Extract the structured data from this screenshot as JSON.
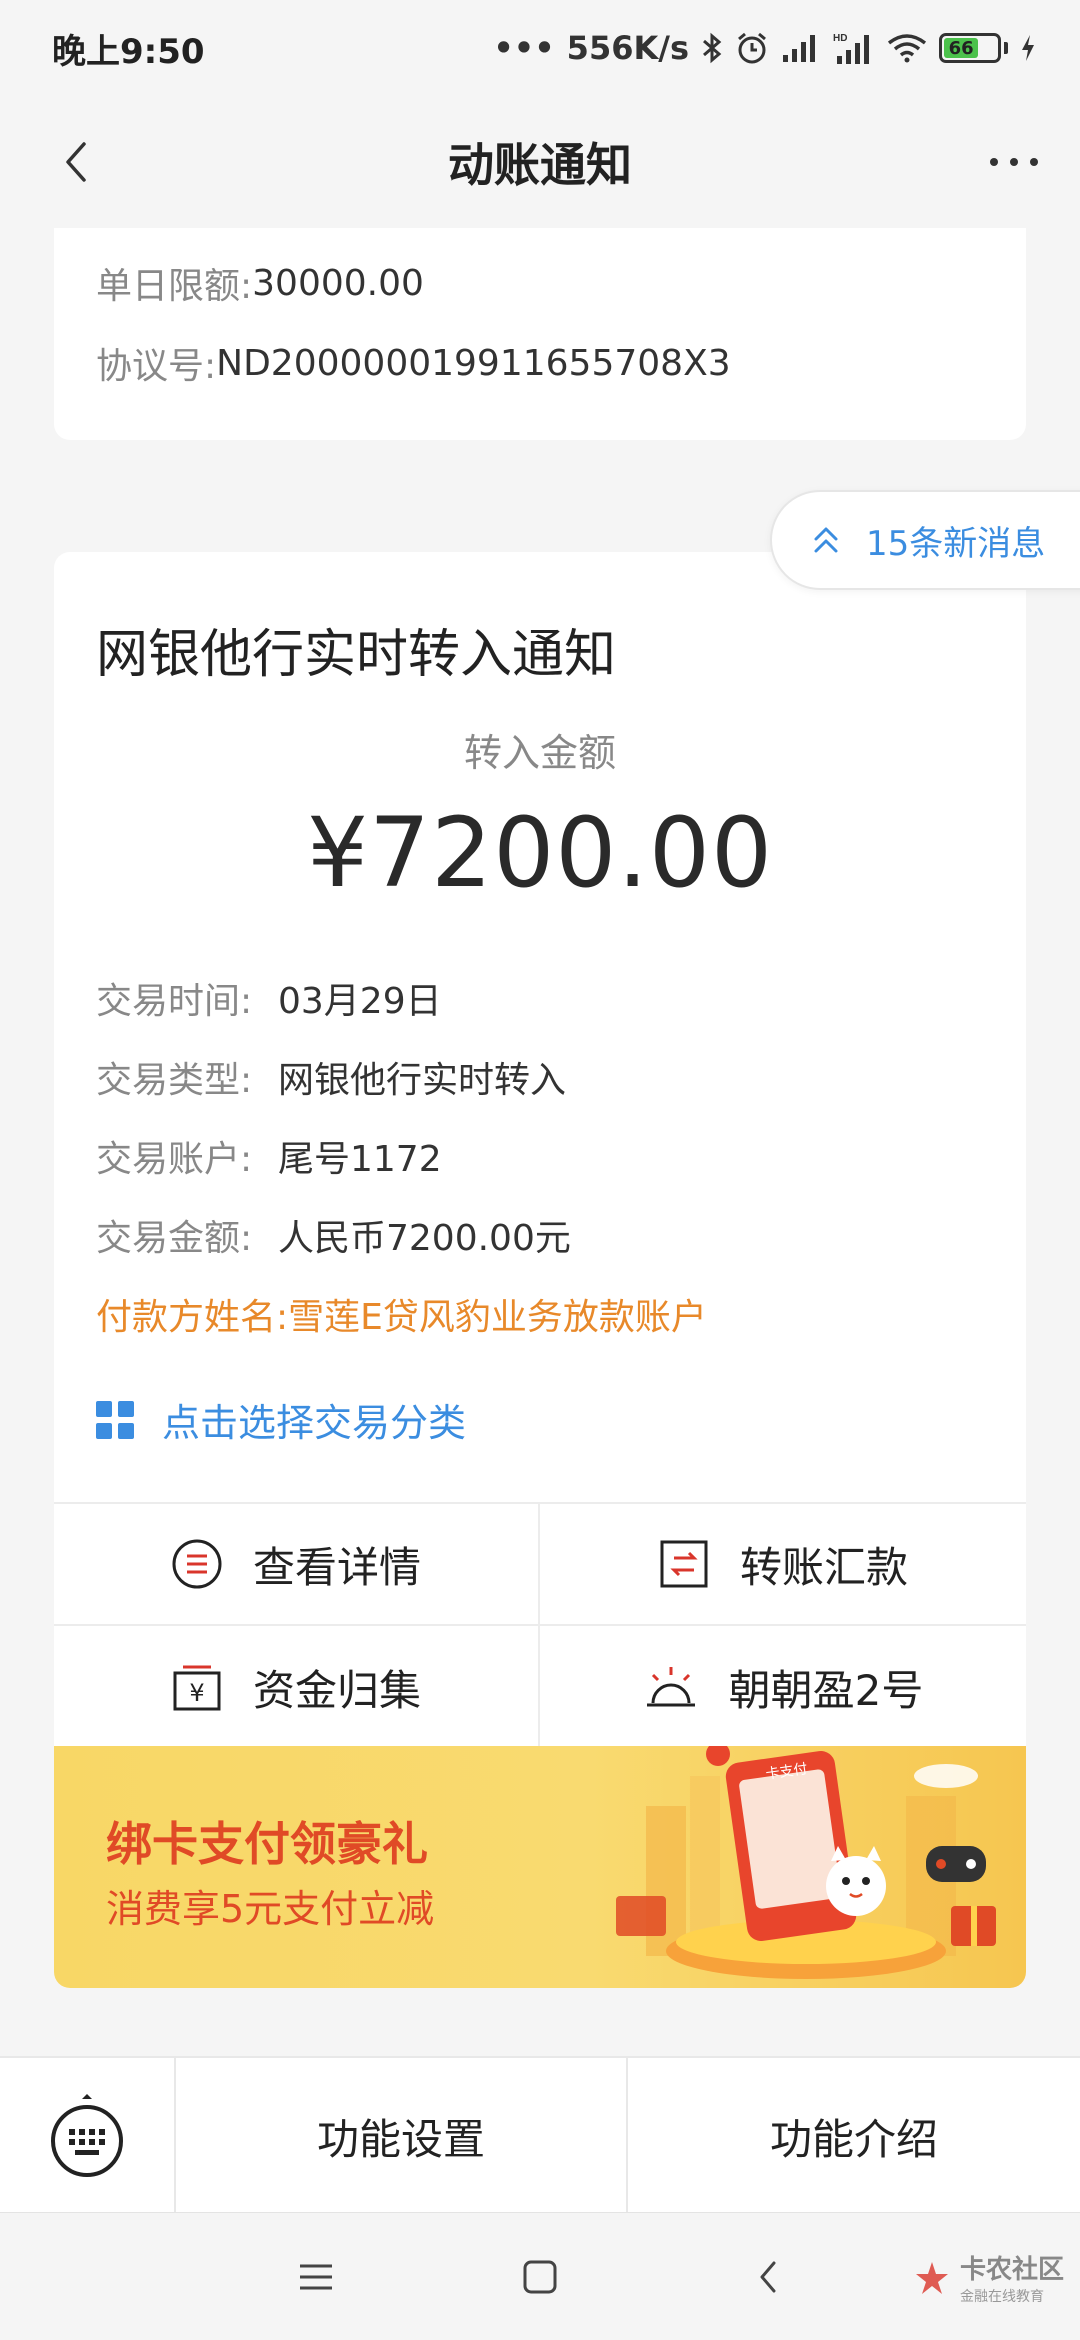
{
  "status_bar": {
    "time": "晚上9:50",
    "speed": "556K/s",
    "battery": "66"
  },
  "nav": {
    "title": "动账通知"
  },
  "top_card": {
    "limit_key": "单日限额:",
    "limit_value": "30000.00",
    "agreement_key": "协议号:",
    "agreement_value": "ND200000019911655708X3"
  },
  "new_messages": "15条新消息",
  "notice": {
    "title": "网银他行实时转入通知",
    "amount_label": "转入金额",
    "amount": "¥7200.00",
    "rows": [
      {
        "key": "交易时间:",
        "value": "03月29日"
      },
      {
        "key": "交易类型:",
        "value": "网银他行实时转入"
      },
      {
        "key": "交易账户:",
        "value": "尾号1172"
      },
      {
        "key": "交易金额:",
        "value": "人民币7200.00元"
      },
      {
        "key": "付款方姓名:",
        "value": "雪莲E贷风豹业务放款账户"
      }
    ],
    "category_link": "点击选择交易分类",
    "actions": [
      "查看详情",
      "转账汇款",
      "资金归集",
      "朝朝盈2号"
    ]
  },
  "banner": {
    "headline": "绑卡支付领豪礼",
    "subline": "消费享5元支付立减",
    "phone_text": "卡支付"
  },
  "function_bar": {
    "settings": "功能设置",
    "intro": "功能介绍"
  },
  "watermark": {
    "name": "卡农社区",
    "tagline": "金融在线教育"
  },
  "colors": {
    "accent_blue": "#3b8de0",
    "payer_orange": "#e8892a",
    "banner_red": "#e04a26"
  }
}
